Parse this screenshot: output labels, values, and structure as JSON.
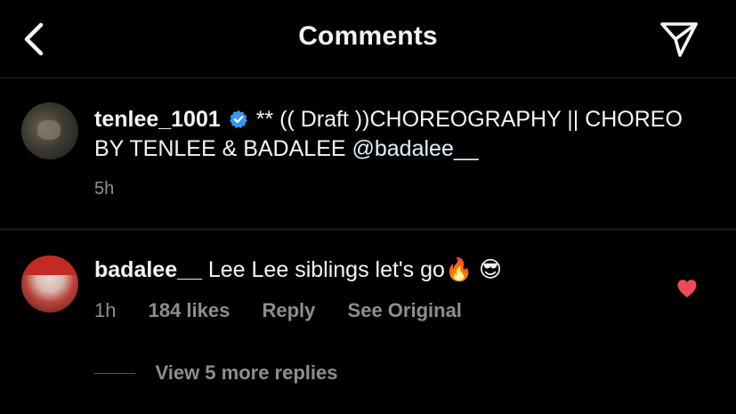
{
  "header": {
    "title": "Comments",
    "back_icon": "chevron-left-icon",
    "share_icon": "paper-plane-icon"
  },
  "post": {
    "username": "tenlee_1001",
    "verified": true,
    "caption_text": "** (( Draft ))CHOREOGRAPHY || CHOREO BY TENLEE & BADALEE ",
    "mention": "@badalee__",
    "time": "5h"
  },
  "comment": {
    "username": "badalee__",
    "text": "Lee Lee siblings let's go",
    "emojis": [
      "🔥",
      "😎"
    ],
    "time": "1h",
    "likes": "184 likes",
    "reply_label": "Reply",
    "see_original_label": "See Original",
    "liked": true
  },
  "replies": {
    "label": "View 5 more replies"
  },
  "colors": {
    "background": "#000000",
    "text": "#f5f5f5",
    "muted": "#8e8e8e",
    "verified": "#3897f0",
    "heart": "#ed4956",
    "divider": "#262626"
  }
}
